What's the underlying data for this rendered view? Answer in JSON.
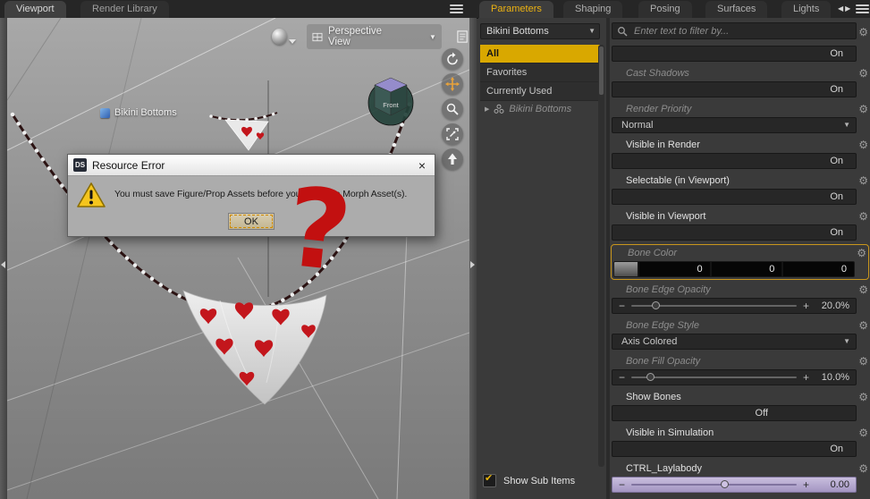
{
  "topbar": {
    "left_tabs": [
      {
        "label": "Viewport"
      },
      {
        "label": "Render Library"
      }
    ],
    "right_tabs": [
      {
        "label": "Parameters"
      },
      {
        "label": "Shaping"
      },
      {
        "label": "Posing"
      },
      {
        "label": "Surfaces"
      },
      {
        "label": "Lights"
      }
    ],
    "scroll_left": "◀",
    "scroll_right": "▶"
  },
  "viewport": {
    "view_mode": "Perspective View",
    "dropdown_arrow": "▼",
    "nav_cube_front_label": "Front",
    "selected_node_label": "Bikini Bottoms",
    "annotation_mark": "?"
  },
  "dialog": {
    "app_icon_text": "DS",
    "title": "Resource Error",
    "close_glyph": "×",
    "message": "You must save Figure/Prop Assets before you can save Morph Asset(s).",
    "ok_label": "OK"
  },
  "scene_pane": {
    "node_selector": "Bikini Bottoms",
    "dropdown_arrow": "▼",
    "filter_items": [
      {
        "label": "All"
      },
      {
        "label": "Favorites"
      },
      {
        "label": "Currently Used"
      }
    ],
    "selected_filter": "All",
    "tree_expand_glyph": "▶",
    "tree_items": [
      {
        "label": "Bikini Bottoms"
      }
    ],
    "show_sub_items": {
      "label": "Show Sub Items",
      "checked": true,
      "check_glyph": "✔"
    }
  },
  "param_pane": {
    "filter_placeholder": "Enter text to filter by...",
    "gear_glyph": "⚙",
    "dropdown_arrow": "▼",
    "slider_minus": "−",
    "slider_plus": "+",
    "rows": [
      {
        "type": "toggle",
        "label": "",
        "value": "On"
      },
      {
        "type": "toggle",
        "label": "Cast Shadows",
        "value": "On",
        "disabled": true
      },
      {
        "type": "dropdown",
        "label": "Render Priority",
        "value": "Normal",
        "disabled": true
      },
      {
        "type": "toggle",
        "label": "Visible in Render",
        "value": "On"
      },
      {
        "type": "toggle",
        "label": "Selectable (in Viewport)",
        "value": "On"
      },
      {
        "type": "toggle",
        "label": "Visible in Viewport",
        "value": "On"
      },
      {
        "type": "color",
        "label": "Bone Color",
        "values": [
          "0",
          "0",
          "0"
        ],
        "disabled": true,
        "highlighted": true
      },
      {
        "type": "slider",
        "label": "Bone Edge Opacity",
        "value": "20.0%",
        "disabled": true,
        "handle_style": "left:15%"
      },
      {
        "type": "dropdown",
        "label": "Bone Edge Style",
        "value": "Axis Colored",
        "disabled": true
      },
      {
        "type": "slider",
        "label": "Bone Fill Opacity",
        "value": "10.0%",
        "disabled": true,
        "handle_style": "left:12%"
      },
      {
        "type": "toggle",
        "label": "Show Bones",
        "value": "Off"
      },
      {
        "type": "toggle",
        "label": "Visible in Simulation",
        "value": "On"
      },
      {
        "type": "slider",
        "label": "CTRL_Laylabody",
        "value": "0.00",
        "accent": true,
        "handle_style": "left:57%"
      }
    ]
  },
  "colors": {
    "accent_yellow": "#ecb211",
    "selection_yellow": "#d9a800",
    "highlight_orange": "#c9961c",
    "annotation_red": "#c21010",
    "ctrl_slider_purple": "#b3a5cf"
  }
}
